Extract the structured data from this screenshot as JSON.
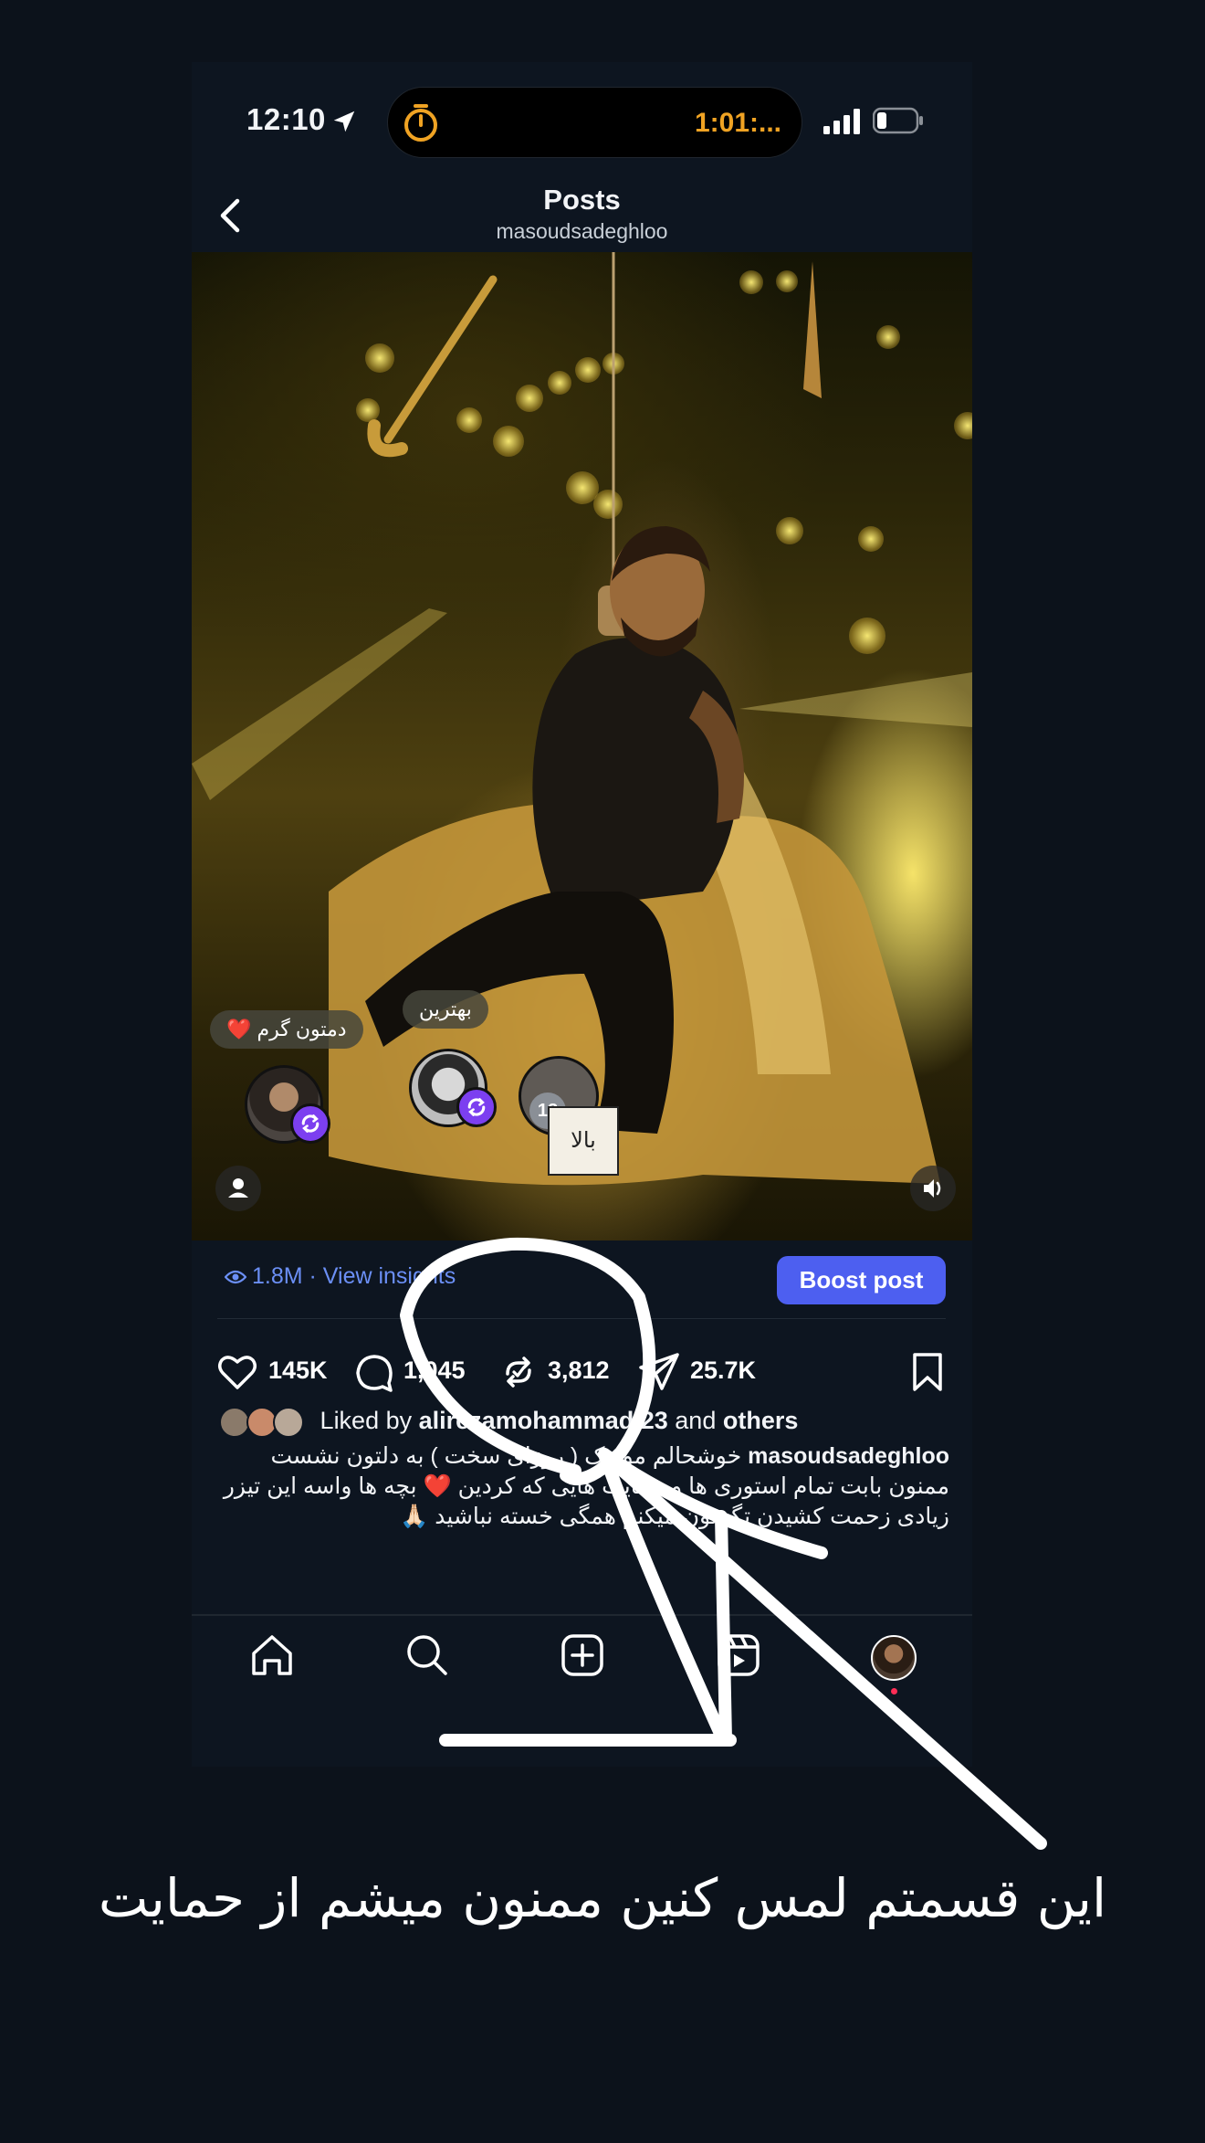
{
  "status_bar": {
    "time": "12:10",
    "live_activity_text": "1:01:..."
  },
  "header": {
    "title": "Posts",
    "username": "masoudsadeghloo"
  },
  "media_overlay": {
    "bubble_left": "دمتون گرم ❤️",
    "bubble_middle": "بهترین",
    "count_badge": "18",
    "album_text": "بالا"
  },
  "insights": {
    "text": "1.8M · View insights",
    "boost_label": "Boost post"
  },
  "actions": {
    "likes": "145K",
    "comments": "1,045",
    "reposts": "3,812",
    "shares": "25.7K"
  },
  "likes_line": {
    "prefix": "Liked by",
    "user": "alirezamohammadi23",
    "middle": "and",
    "others": "others"
  },
  "caption": {
    "username": "masoudsadeghloo",
    "text": "خوشحالم موزیک ( روزای سخت ) به دلتون نشست ممنون بابت تمام استوری ها و حمایت هایی که کردین ❤️ بچه ها واسه این تیزر زیادی زحمت کشیدن تگشون میکنم همگی خسته نباشید 🙏🏻"
  },
  "nav": {
    "items": [
      "home-icon",
      "search-icon",
      "create-icon",
      "reels-icon",
      "profile-avatar"
    ]
  },
  "annotation": {
    "message": "این قسمتم لمس کنین ممنون میشم از حمایت"
  },
  "colors": {
    "background": "#0c121b",
    "accent_blue": "#4d5ff0",
    "insights_blue": "#6b8ff5",
    "timer_orange": "#f0a323",
    "repost_purple": "#7c3ff0"
  }
}
